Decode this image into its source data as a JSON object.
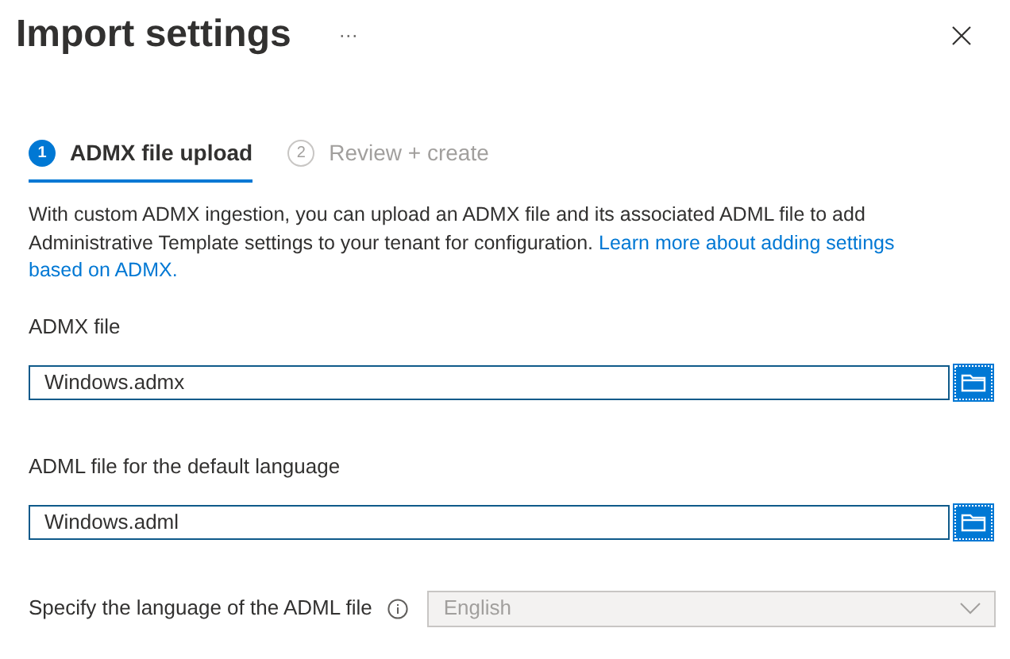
{
  "title": "Import settings",
  "more_button": "···",
  "steps": [
    {
      "number": "1",
      "label": "ADMX file upload",
      "selected": true
    },
    {
      "number": "2",
      "label": "Review + create",
      "selected": false
    }
  ],
  "description": {
    "text": "With custom ADMX ingestion, you can upload an ADMX file and its associated ADML file to add Administrative Template settings to your tenant for configuration.",
    "link_lines": [
      "Learn more about adding settings",
      "based on ADMX."
    ]
  },
  "file_fields": [
    {
      "label": "ADMX file",
      "value": "Windows.admx"
    },
    {
      "label": "ADML file for the default language",
      "value": "Windows.adml"
    }
  ],
  "language": {
    "label": "Specify the language of the ADML file",
    "value": "English",
    "disabled": true
  }
}
